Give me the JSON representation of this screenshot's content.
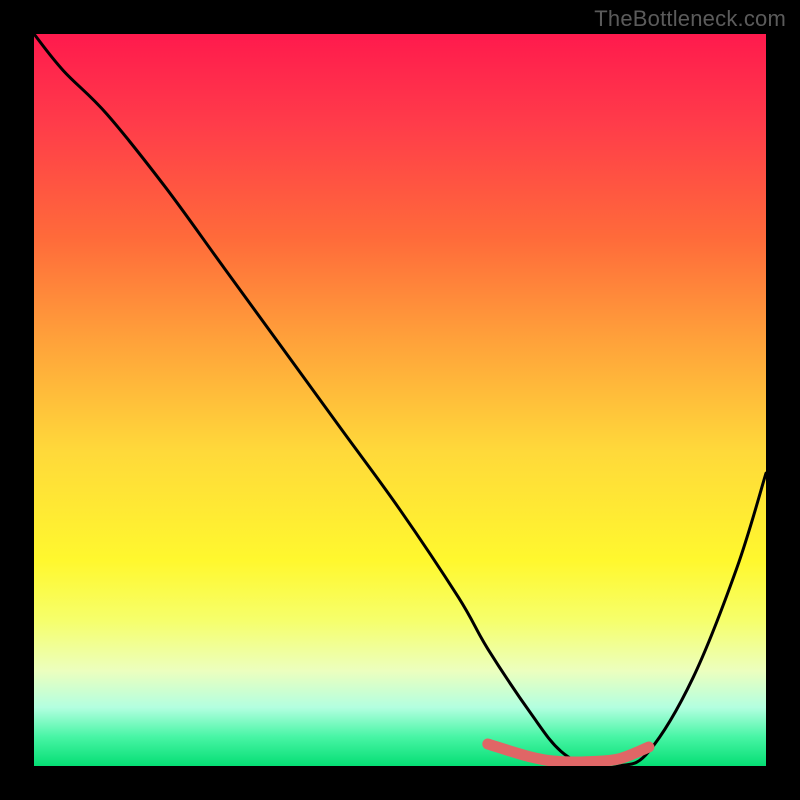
{
  "attribution": "TheBottleneck.com",
  "chart_data": {
    "type": "line",
    "title": "",
    "xlabel": "",
    "ylabel": "",
    "xlim": [
      0,
      100
    ],
    "ylim": [
      0,
      100
    ],
    "grid": false,
    "legend": false,
    "series": [
      {
        "name": "bottleneck-curve",
        "x": [
          0,
          4,
          10,
          18,
          26,
          34,
          42,
          50,
          58,
          62,
          68,
          72,
          76,
          80,
          84,
          90,
          96,
          100
        ],
        "y": [
          100,
          95,
          89,
          79,
          68,
          57,
          46,
          35,
          23,
          16,
          7,
          2,
          0,
          0,
          2,
          12,
          27,
          40
        ],
        "color": "#000000"
      },
      {
        "name": "recommended-zone",
        "x": [
          62,
          68,
          72,
          76,
          80,
          84
        ],
        "y": [
          3,
          1.2,
          0.6,
          0.6,
          1.0,
          2.6
        ],
        "color": "#e06666"
      }
    ],
    "annotations": []
  },
  "colors": {
    "frame": "#000000",
    "attribution": "#5b5b5b",
    "curve": "#000000",
    "recommended_zone": "#e06666",
    "gradient_top": "#ff1a4d",
    "gradient_bottom": "#05de74"
  }
}
